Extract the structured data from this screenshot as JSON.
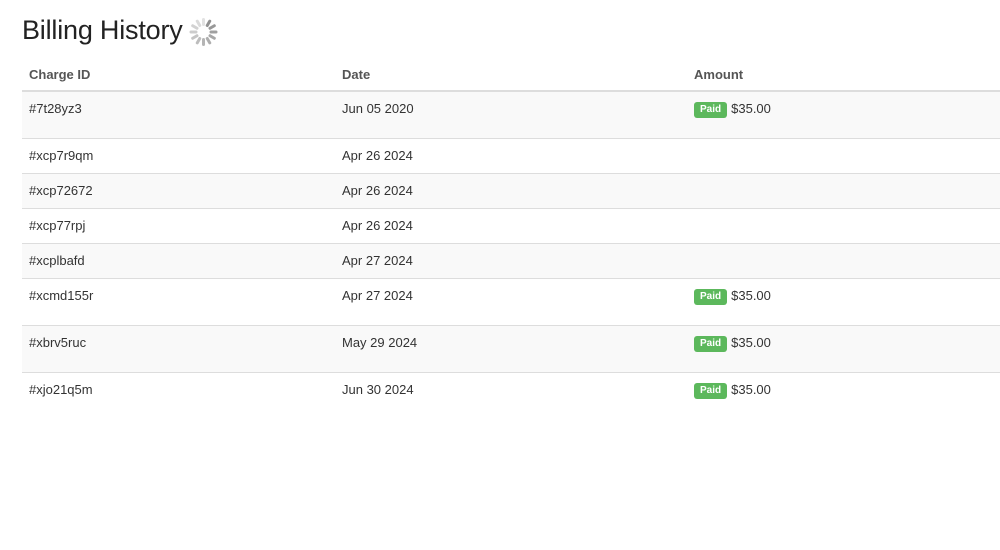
{
  "page": {
    "title": "Billing History"
  },
  "table": {
    "headers": {
      "charge_id": "Charge ID",
      "date": "Date",
      "amount": "Amount"
    },
    "rows": [
      {
        "id": "#7t28yz3",
        "date": "Jun 05 2020",
        "status": "Paid",
        "amount": "$35.00"
      },
      {
        "id": "#xcp7r9qm",
        "date": "Apr 26 2024",
        "status": "",
        "amount": ""
      },
      {
        "id": "#xcp72672",
        "date": "Apr 26 2024",
        "status": "",
        "amount": ""
      },
      {
        "id": "#xcp77rpj",
        "date": "Apr 26 2024",
        "status": "",
        "amount": ""
      },
      {
        "id": "#xcplbafd",
        "date": "Apr 27 2024",
        "status": "",
        "amount": ""
      },
      {
        "id": "#xcmd155r",
        "date": "Apr 27 2024",
        "status": "Paid",
        "amount": "$35.00"
      },
      {
        "id": "#xbrv5ruc",
        "date": "May 29 2024",
        "status": "Paid",
        "amount": "$35.00"
      },
      {
        "id": "#xjo21q5m",
        "date": "Jun 30 2024",
        "status": "Paid",
        "amount": "$35.00"
      }
    ]
  },
  "icons": {
    "loading": "loading-spinner-icon"
  },
  "colors": {
    "paid_badge": "#5cb85c",
    "row_stripe": "#f9f9f9",
    "border": "#dddddd"
  }
}
